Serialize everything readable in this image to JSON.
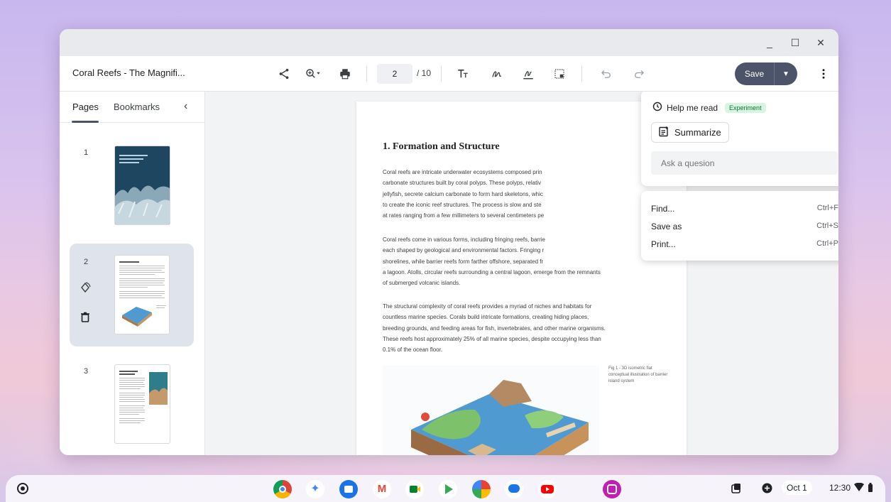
{
  "window": {
    "minimize": "_",
    "maximize": "☐",
    "close": "✕"
  },
  "toolbar": {
    "doc_title": "Coral Reefs - The Magnifi...",
    "current_page": "2",
    "total_pages": "/ 10",
    "save_label": "Save"
  },
  "sidebar": {
    "tabs": [
      "Pages",
      "Bookmarks"
    ],
    "pages": [
      {
        "num": "1"
      },
      {
        "num": "2"
      },
      {
        "num": "3"
      }
    ]
  },
  "document": {
    "heading": "1. Formation and Structure",
    "paragraphs": [
      "Coral reefs are intricate underwater ecosystems composed prin",
      "carbonate structures built by coral polyps. These polyps, relativ",
      "jellyfish, secrete calcium carbonate to form hard skeletons, whic",
      "to create the iconic reef structures. The process is slow and ste",
      "at rates ranging from a few millimeters to several centimeters pe"
    ],
    "paragraph2": [
      "Coral reefs come in various forms, including fringing reefs, barrie",
      "each shaped by geological and environmental factors. Fringing r",
      "shorelines, while barrier reefs form farther offshore, separated fr",
      "a lagoon. Atolls, circular reefs surrounding a central lagoon, emerge from the remnants",
      "of submerged volcanic islands."
    ],
    "paragraph3": [
      "The structural complexity of coral reefs provides a myriad of niches and habitats for",
      "countless marine species. Corals build intricate formations, creating hiding places,",
      "breeding grounds, and feeding areas for fish, invertebrates, and other marine organisms.",
      "These reefs host approximately 25% of all marine species, despite occupying less than",
      "0.1% of the ocean floor."
    ],
    "figure_caption": "Fig 1 - 3D isometric flat conceptual illustration of barrier island system"
  },
  "help_panel": {
    "title": "Help me read",
    "badge": "Experiment",
    "summarize_label": "Summarize",
    "ask_placeholder": "Ask a quesion"
  },
  "menu": {
    "items": [
      {
        "label": "Find...",
        "shortcut": "Ctrl+F"
      },
      {
        "label": "Save as",
        "shortcut": "Ctrl+S"
      },
      {
        "label": "Print...",
        "shortcut": "Ctrl+P"
      }
    ]
  },
  "shelf": {
    "date": "Oct 1",
    "time": "12:30"
  },
  "colors": {
    "save_button": "#4b5468",
    "experiment_badge_bg": "#d7f5e3",
    "selected_thumb_bg": "#dfe3ec"
  }
}
